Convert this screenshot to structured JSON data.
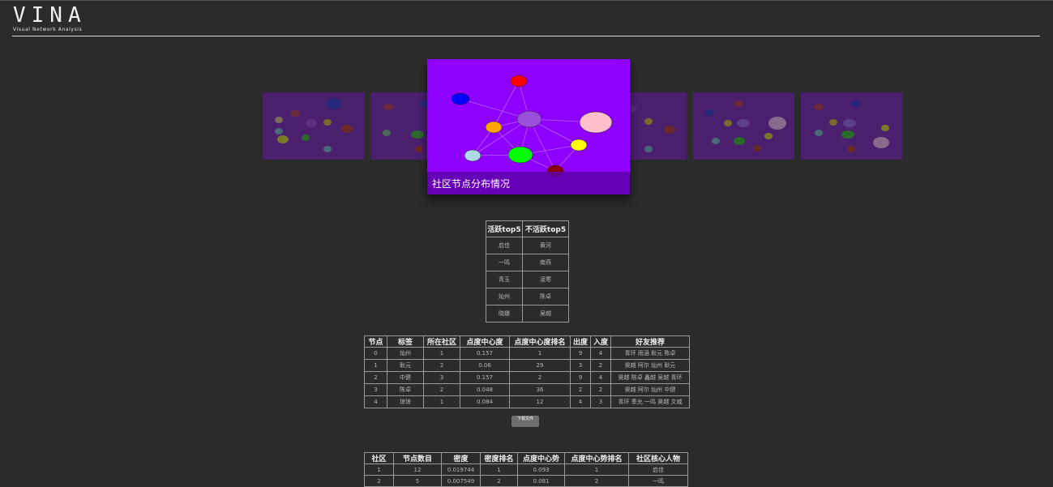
{
  "header": {
    "logo_title": "VINA",
    "logo_subtitle": "Visual Network Analysis"
  },
  "carousel": {
    "caption": "社区节点分布情况"
  },
  "activity_table": {
    "headers": [
      "活跃top5",
      "不活跃top5"
    ],
    "rows": [
      [
        "启佳",
        "黄河"
      ],
      [
        "一鸣",
        "南燕"
      ],
      [
        "青玉",
        "凌寒"
      ],
      [
        "灿州",
        "陈卓"
      ],
      [
        "晓娜",
        "吴越"
      ]
    ]
  },
  "node_table": {
    "headers": [
      "节点",
      "标签",
      "所在社区",
      "点度中心度",
      "点度中心度排名",
      "出度",
      "入度",
      "好友推荐"
    ],
    "rows": [
      [
        "0",
        "灿州",
        "1",
        "0.157",
        "1",
        "9",
        "4",
        "青环 雨涵 耿元 陈卓"
      ],
      [
        "1",
        "耿元",
        "2",
        "0.06",
        "29",
        "3",
        "2",
        "昊越 阿尔 灿州 耿元"
      ],
      [
        "2",
        "中健",
        "3",
        "0.157",
        "2",
        "9",
        "4",
        "昊越 陈卓 鑫越 吴越 青环"
      ],
      [
        "3",
        "陈卓",
        "2",
        "0.048",
        "36",
        "2",
        "2",
        "昊越 阿尔 灿州 中健"
      ],
      [
        "4",
        "琼琼",
        "1",
        "0.084",
        "12",
        "4",
        "3",
        "青环 季允 一鸣 昊越 文威"
      ]
    ]
  },
  "download_button": {
    "label": "下载文件"
  },
  "community_table": {
    "headers": [
      "社区",
      "节点数目",
      "密度",
      "密度排名",
      "点度中心势",
      "点度中心势排名",
      "社区核心人物"
    ],
    "rows": [
      [
        "1",
        "12",
        "0.019744",
        "1",
        "0.093",
        "1",
        "启佳"
      ],
      [
        "2",
        "5",
        "0.007549",
        "2",
        "0.081",
        "2",
        "一鸣"
      ]
    ]
  },
  "colors": {
    "background": "#2b2b2b",
    "main_slide": "#8e00ff",
    "side_slide": "#4a1f6e"
  }
}
